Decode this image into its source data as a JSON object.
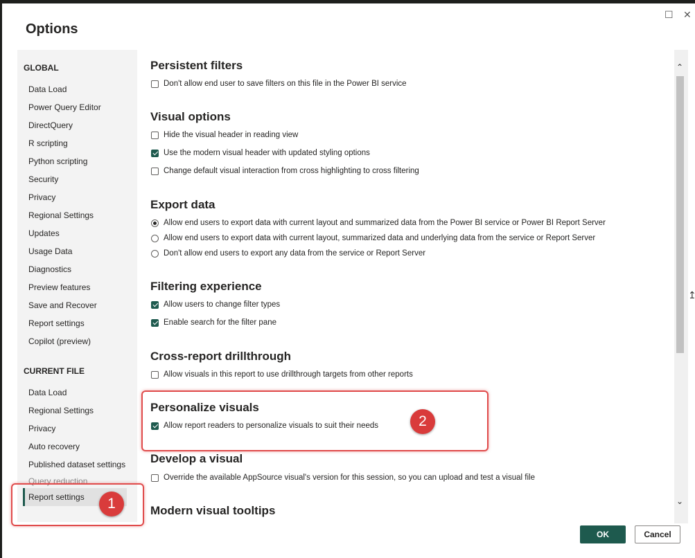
{
  "dialog": {
    "title": "Options",
    "restore_glyph": "☐",
    "close_glyph": "✕"
  },
  "sidebar": {
    "global_header": "GLOBAL",
    "global_items": [
      "Data Load",
      "Power Query Editor",
      "DirectQuery",
      "R scripting",
      "Python scripting",
      "Security",
      "Privacy",
      "Regional Settings",
      "Updates",
      "Usage Data",
      "Diagnostics",
      "Preview features",
      "Save and Recover",
      "Report settings",
      "Copilot (preview)"
    ],
    "current_header": "CURRENT FILE",
    "current_items": [
      "Data Load",
      "Regional Settings",
      "Privacy",
      "Auto recovery",
      "Published dataset settings",
      "Query reduction"
    ],
    "selected_item": "Report settings"
  },
  "content": {
    "persistent": {
      "title": "Persistent filters",
      "options": [
        {
          "label": "Don't allow end user to save filters on this file in the Power BI service",
          "checked": false
        }
      ]
    },
    "visual": {
      "title": "Visual options",
      "options": [
        {
          "label": "Hide the visual header in reading view",
          "checked": false
        },
        {
          "label": "Use the modern visual header with updated styling options",
          "checked": true
        },
        {
          "label": "Change default visual interaction from cross highlighting to cross filtering",
          "checked": false
        }
      ]
    },
    "export": {
      "title": "Export data",
      "options": [
        {
          "label": "Allow end users to export data with current layout and summarized data from the Power BI service or Power BI Report Server",
          "selected": true
        },
        {
          "label": "Allow end users to export data with current layout, summarized data and underlying data from the service or Report Server",
          "selected": false
        },
        {
          "label": "Don't allow end users to export any data from the service or Report Server",
          "selected": false
        }
      ]
    },
    "filtering": {
      "title": "Filtering experience",
      "options": [
        {
          "label": "Allow users to change filter types",
          "checked": true
        },
        {
          "label": "Enable search for the filter pane",
          "checked": true
        }
      ]
    },
    "drill": {
      "title": "Cross-report drillthrough",
      "options": [
        {
          "label": "Allow visuals in this report to use drillthrough targets from other reports",
          "checked": false
        }
      ]
    },
    "personalize": {
      "title": "Personalize visuals",
      "options": [
        {
          "label": "Allow report readers to personalize visuals to suit their needs",
          "checked": true
        }
      ]
    },
    "develop": {
      "title": "Develop a visual",
      "options": [
        {
          "label": "Override the available AppSource visual's version for this session, so you can upload and test a visual file",
          "checked": false
        }
      ]
    },
    "tooltips": {
      "title": "Modern visual tooltips"
    }
  },
  "annotations": {
    "badge1": "1",
    "badge2": "2",
    "highlight_color": "#e04b4b"
  },
  "buttons": {
    "ok": "OK",
    "cancel": "Cancel"
  },
  "colors": {
    "accent": "#1e5a4e"
  }
}
